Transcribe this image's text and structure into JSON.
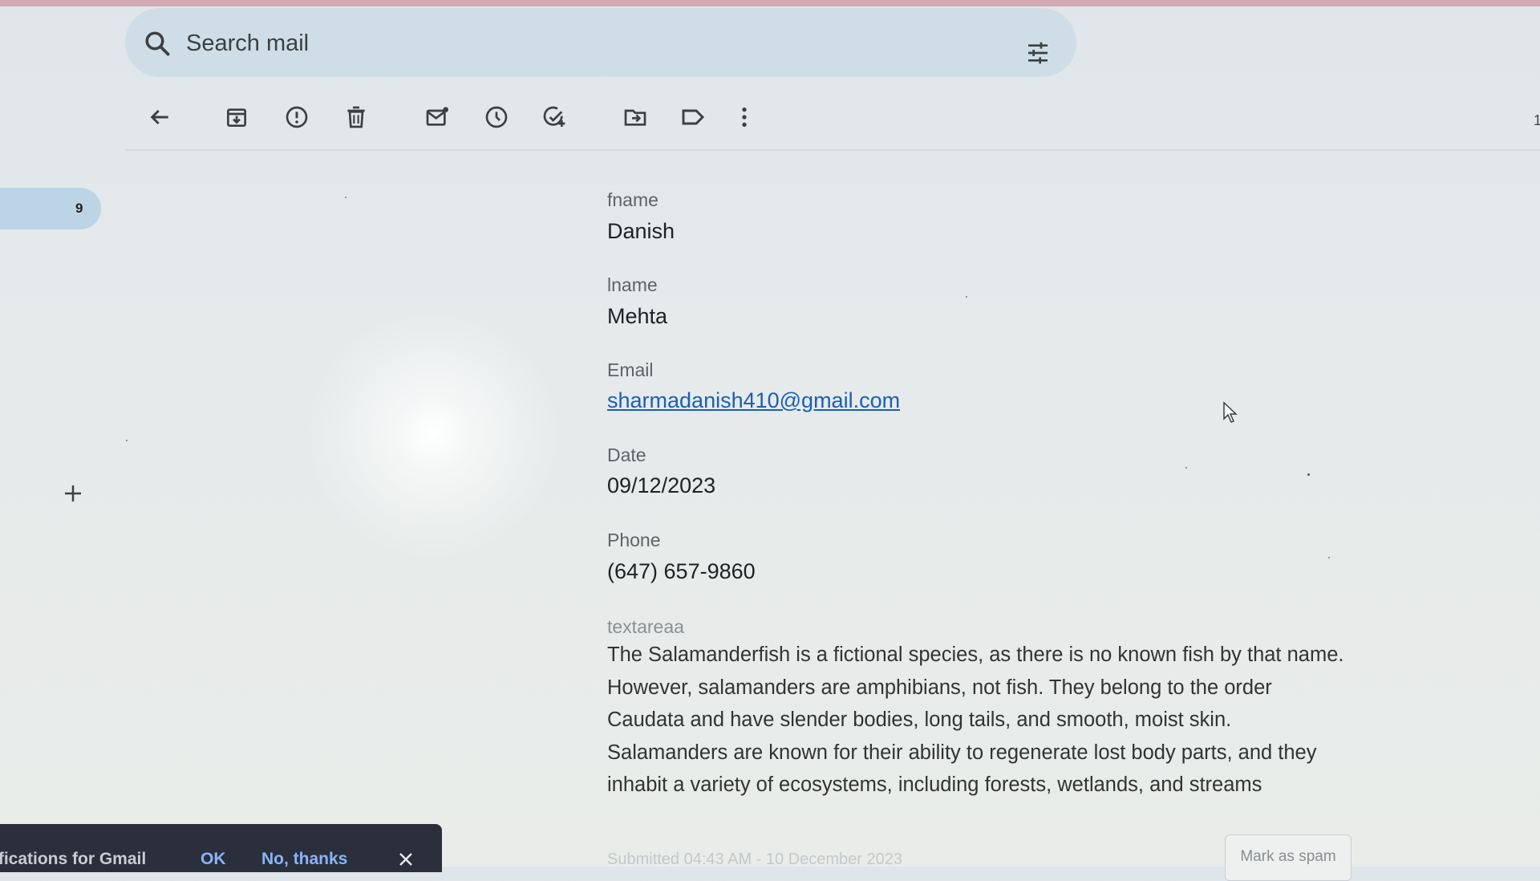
{
  "search": {
    "placeholder": "Search mail"
  },
  "toolbar": {
    "items": [
      {
        "icon": "back-arrow-icon"
      },
      {
        "icon": "archive-icon"
      },
      {
        "icon": "report-spam-icon"
      },
      {
        "icon": "delete-icon"
      },
      {
        "icon": "mark-unread-icon"
      },
      {
        "icon": "snooze-icon"
      },
      {
        "icon": "add-to-tasks-icon"
      },
      {
        "icon": "move-to-icon"
      },
      {
        "icon": "label-icon"
      },
      {
        "icon": "more-vert-icon"
      }
    ]
  },
  "nav": {
    "count": "9"
  },
  "form": {
    "fname_label": "fname",
    "fname_value": "Danish",
    "lname_label": "lname",
    "lname_value": "Mehta",
    "email_label": "Email",
    "email_value": "sharmadanish410@gmail.com",
    "date_label": "Date",
    "date_value": "09/12/2023",
    "phone_label": "Phone",
    "phone_value": "(647) 657-9860",
    "textarea_label": "textareaa",
    "textarea_value": "The Salamanderfish is a fictional species, as there is no known fish by that name. However, salamanders are amphibians, not fish. They belong to the order Caudata and have slender bodies, long tails, and smooth, moist skin. Salamanders are known for their ability to regenerate lost body parts, and they inhabit a variety of ecosystems, including forests, wetlands, and streams"
  },
  "footer": {
    "submitted": "Submitted 04:43 AM - 10 December 2023",
    "mark_spam": "Mark as spam"
  },
  "snackbar": {
    "text": "ifications for Gmail",
    "ok": "OK",
    "no_thanks": "No, thanks"
  },
  "edge_text": "1",
  "colors": {
    "link": "#1a5fb4",
    "snackbar_bg": "#2a2f3b",
    "snackbar_action": "#8ab4f8",
    "nav_active": "#bcd5e6"
  }
}
